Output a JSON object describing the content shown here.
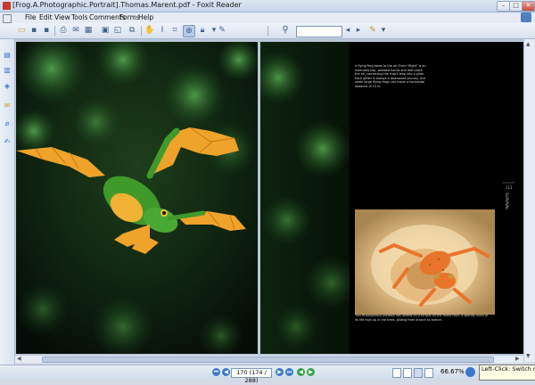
{
  "window": {
    "title": "[Frog.A.Photographic.Portrait].Thomas.Marent.pdf - Foxit Reader",
    "title_prefix_label": "[Frog.A.Photographic.Portrait].Thomas.Marent.pdf - Foxit Reader",
    "minimize_label": "–",
    "maximize_label": "□",
    "close_label": "✕"
  },
  "menu": {
    "items": [
      "File",
      "Edit",
      "View",
      "Tools",
      "Comments",
      "Forms",
      "Help"
    ]
  },
  "toolbar": {
    "search_placeholder": ""
  },
  "document": {
    "caption_top": "A flying frog takes to the air. Even \"flight\" is an extended hop, webbed hands and feet catch the air, converting the frog's leap into a glide. Each glider is always a downward journey, but some large flying frogs can travel a horizontal distance of 15 m.",
    "caption_bottom": "This Rhacophorus pardalis has landed on a fungus on the forest floor. It spends much of its life high up in the trees, gliding from branch to branch.",
    "page_number_right": "111",
    "section_label": "SURVIVAL"
  },
  "statusbar": {
    "page_field": "170 (174 / 288)",
    "zoom": "66.67%",
    "tooltip": "Left-Click: Switch rende"
  },
  "colors": {
    "accent": "#3c78c8",
    "frog_green": "#3f9a2a",
    "frog_orange": "#f0a32a"
  }
}
